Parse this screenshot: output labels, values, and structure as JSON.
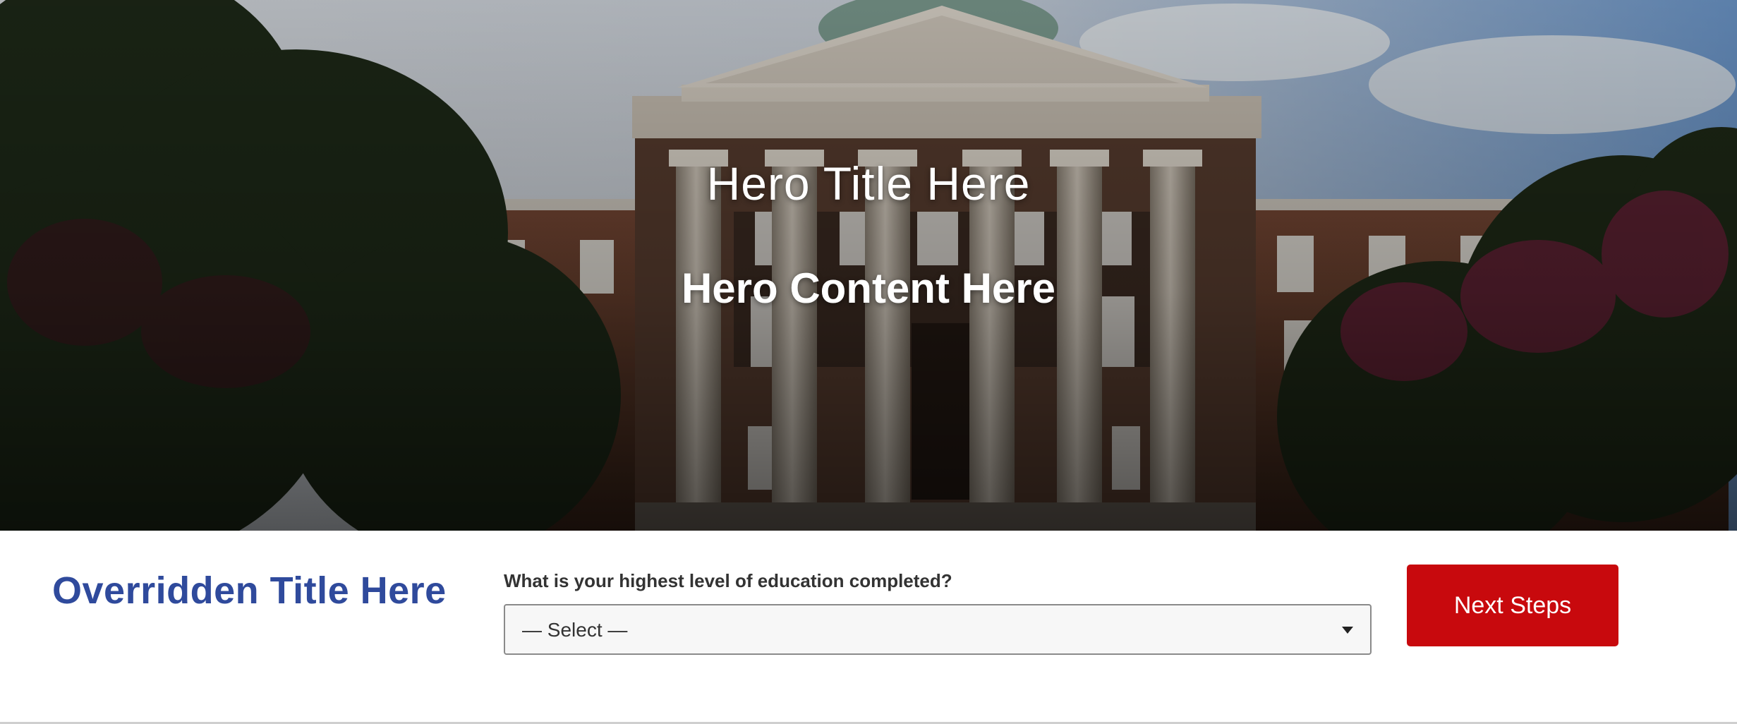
{
  "hero": {
    "title": "Hero Title Here",
    "content": "Hero Content Here",
    "image_icon": "university-building-photo"
  },
  "form": {
    "title": "Overridden Title Here",
    "question": "What is your highest level of education completed?",
    "select": {
      "value": "— Select —",
      "icon": "chevron-down-icon"
    },
    "next_button": "Next Steps"
  },
  "colors": {
    "title_blue": "#2f4a9c",
    "button_red": "#c8090d",
    "text_dark": "#333333"
  }
}
